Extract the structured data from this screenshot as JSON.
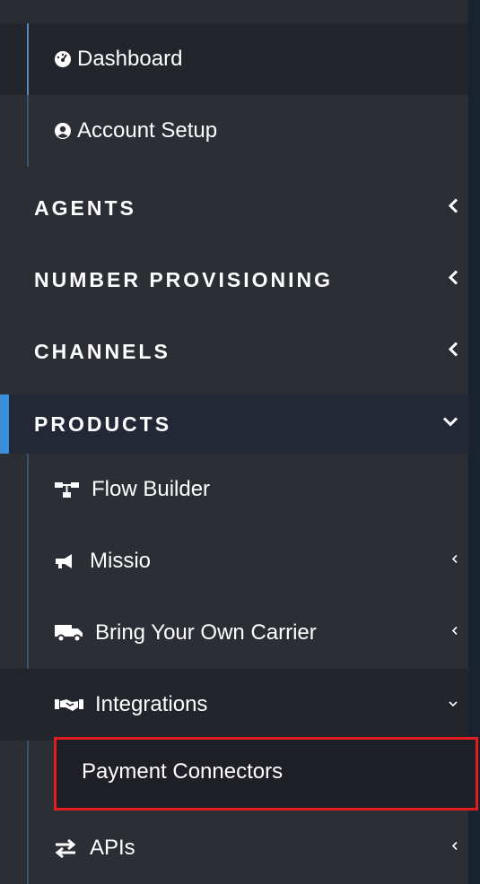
{
  "menu": {
    "dashboard": "Dashboard",
    "account_setup": "Account Setup",
    "agents": "AGENTS",
    "number_provisioning": "NUMBER PROVISIONING",
    "channels": "CHANNELS",
    "products": "PRODUCTS",
    "flow_builder": "Flow Builder",
    "missio": "Missio",
    "byoc": "Bring Your Own Carrier",
    "integrations": "Integrations",
    "payment_connectors": "Payment Connectors",
    "apis": "APIs"
  },
  "colors": {
    "background": "#2c2e35",
    "active_item": "#23252c",
    "section_active": "#222836",
    "accent": "#3a8fd8",
    "highlight_border": "#e11d1d"
  },
  "icons": {
    "dashboard": "tachometer-icon",
    "account_setup": "user-circle-icon",
    "flow_builder": "sitemap-icon",
    "missio": "megaphone-icon",
    "byoc": "truck-icon",
    "integrations": "handshake-icon",
    "apis": "exchange-arrows-icon"
  }
}
